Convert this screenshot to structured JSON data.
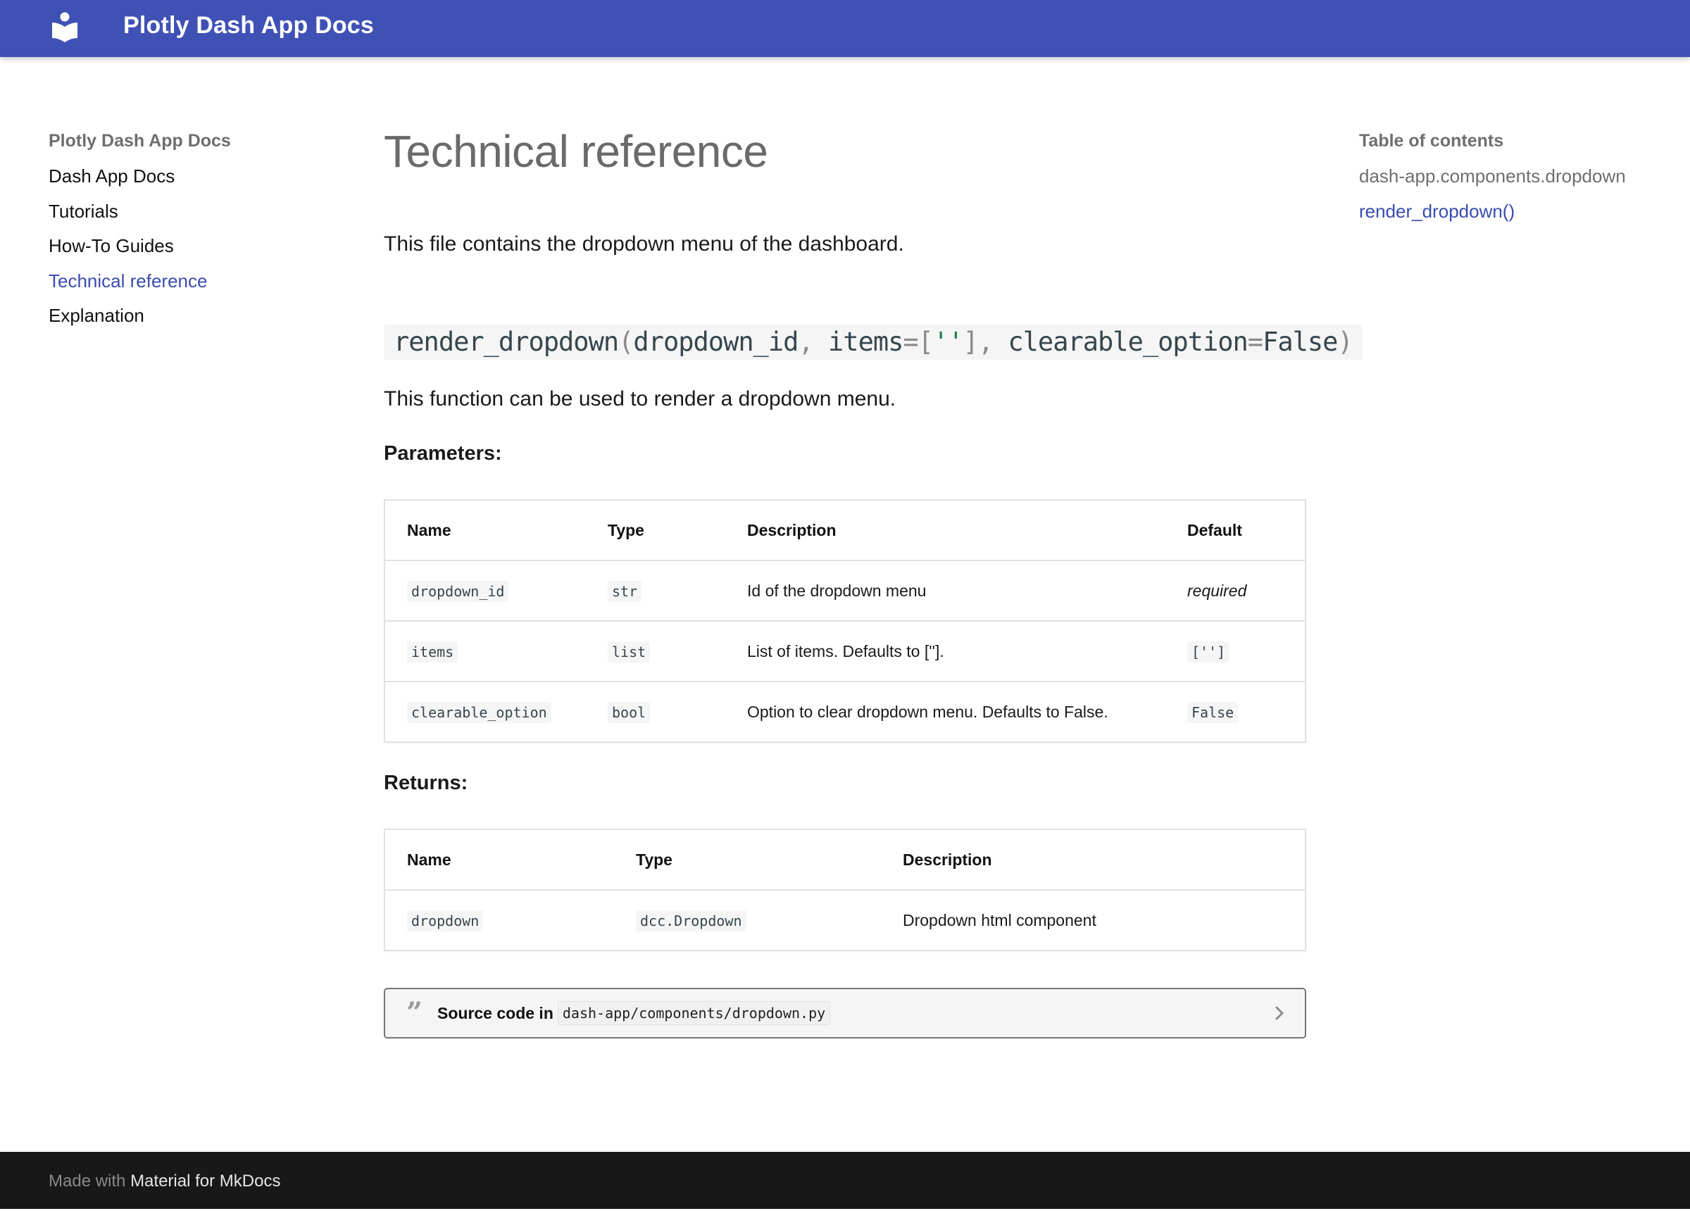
{
  "header": {
    "logo_icon": "book-reader-icon",
    "title": "Plotly Dash App Docs"
  },
  "sidebar": {
    "title": "Plotly Dash App Docs",
    "items": [
      {
        "label": "Dash App Docs",
        "active": false
      },
      {
        "label": "Tutorials",
        "active": false
      },
      {
        "label": "How-To Guides",
        "active": false
      },
      {
        "label": "Technical reference",
        "active": true
      },
      {
        "label": "Explanation",
        "active": false
      }
    ]
  },
  "main": {
    "page_title": "Technical reference",
    "intro": "This file contains the dropdown menu of the dashboard.",
    "signature": {
      "name": "render_dropdown",
      "open_paren": "(",
      "arg1": "dropdown_id",
      "comma1": ",",
      "arg2": " items",
      "eq1": "=",
      "bracket_open": "[",
      "str_literal": "''",
      "bracket_close": "]",
      "comma2": ",",
      "arg3": " clearable_option",
      "eq2": "=",
      "default3": "False",
      "close_paren": ")"
    },
    "function_description": "This function can be used to render a dropdown menu.",
    "parameters": {
      "heading": "Parameters:",
      "columns": [
        "Name",
        "Type",
        "Description",
        "Default"
      ],
      "rows": [
        {
          "name": "dropdown_id",
          "type": "str",
          "description": "Id of the dropdown menu",
          "default": "required",
          "default_style": "italic"
        },
        {
          "name": "items",
          "type": "list",
          "description": "List of items. Defaults to [''].",
          "default": "['']",
          "default_style": "code"
        },
        {
          "name": "clearable_option",
          "type": "bool",
          "description": "Option to clear dropdown menu. Defaults to False.",
          "default": "False",
          "default_style": "code"
        }
      ]
    },
    "returns": {
      "heading": "Returns:",
      "columns": [
        "Name",
        "Type",
        "Description"
      ],
      "rows": [
        {
          "name": "dropdown",
          "type": "dcc.Dropdown",
          "description": "Dropdown html component"
        }
      ]
    },
    "source": {
      "icon": "quote-icon",
      "label": "Source code in",
      "path": "dash-app/components/dropdown.py",
      "expand_icon": "chevron-right-icon"
    }
  },
  "toc": {
    "title": "Table of contents",
    "items": [
      {
        "label": "dash-app.components.dropdown",
        "active": false
      },
      {
        "label": "render_dropdown()",
        "active": true
      }
    ]
  },
  "footer": {
    "prefix": "Made with",
    "link": "Material for MkDocs"
  },
  "colors": {
    "primary": "#4051b5",
    "accent_link": "#3a4bb0",
    "footer_bg": "#181818"
  }
}
